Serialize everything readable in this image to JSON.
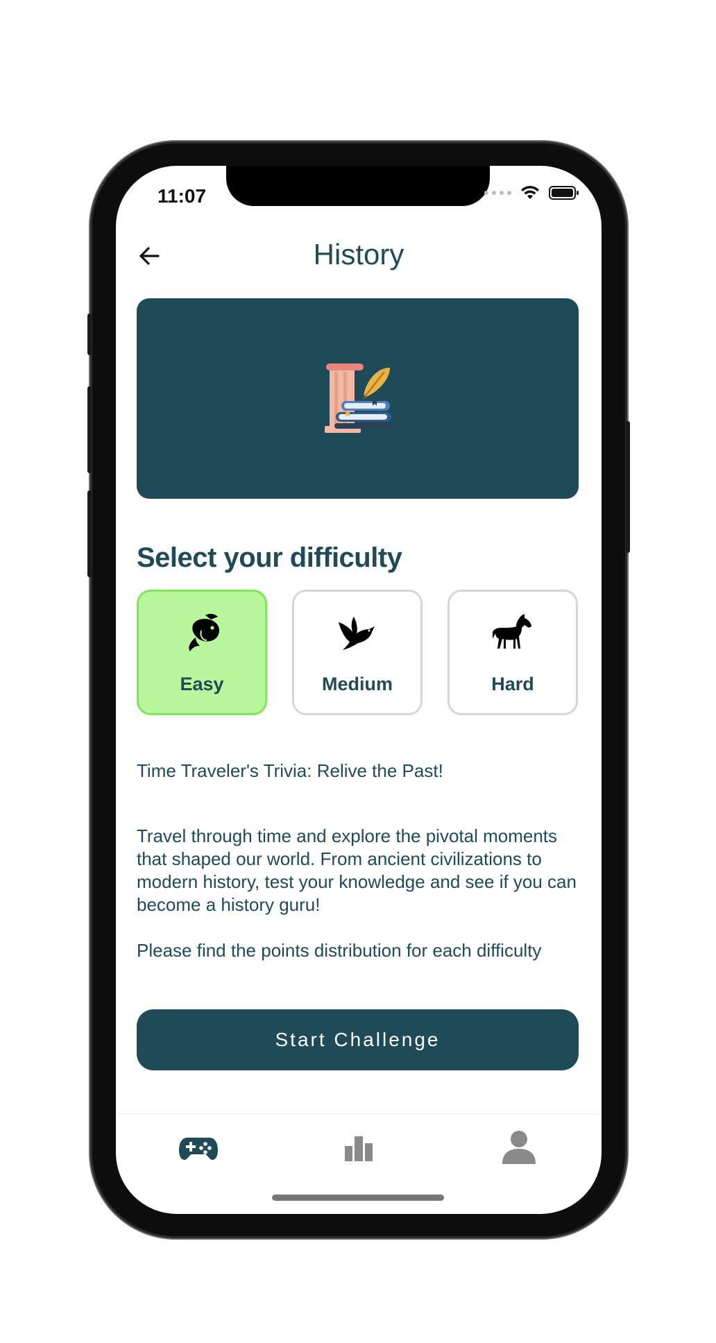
{
  "status_bar": {
    "time": "11:07"
  },
  "header": {
    "title": "History"
  },
  "banner": {
    "icon": "history-column-books-quill-icon"
  },
  "difficulty": {
    "heading": "Select your difficulty",
    "options": [
      {
        "label": "Easy",
        "icon": "fish-icon",
        "selected": true
      },
      {
        "label": "Medium",
        "icon": "bird-icon",
        "selected": false
      },
      {
        "label": "Hard",
        "icon": "horse-icon",
        "selected": false
      }
    ]
  },
  "description": {
    "tagline": "Time Traveler's Trivia: Relive the Past!",
    "body": "Travel through time and explore the pivotal moments that shaped our world. From ancient civilizations to modern history, test your knowledge and see if you can become a history guru!",
    "points_note": "Please find the points distribution for each difficulty"
  },
  "start_button": {
    "label": "Start Challenge"
  },
  "tab_bar": {
    "tabs": [
      {
        "icon": "gamepad-icon",
        "active": true
      },
      {
        "icon": "leaderboard-icon",
        "active": false
      },
      {
        "icon": "profile-icon",
        "active": false
      }
    ]
  },
  "colors": {
    "primary": "#1f4a58",
    "selected_bg": "#b8f79b",
    "selected_border": "#7ee85a",
    "inactive": "#8a8a8a"
  }
}
